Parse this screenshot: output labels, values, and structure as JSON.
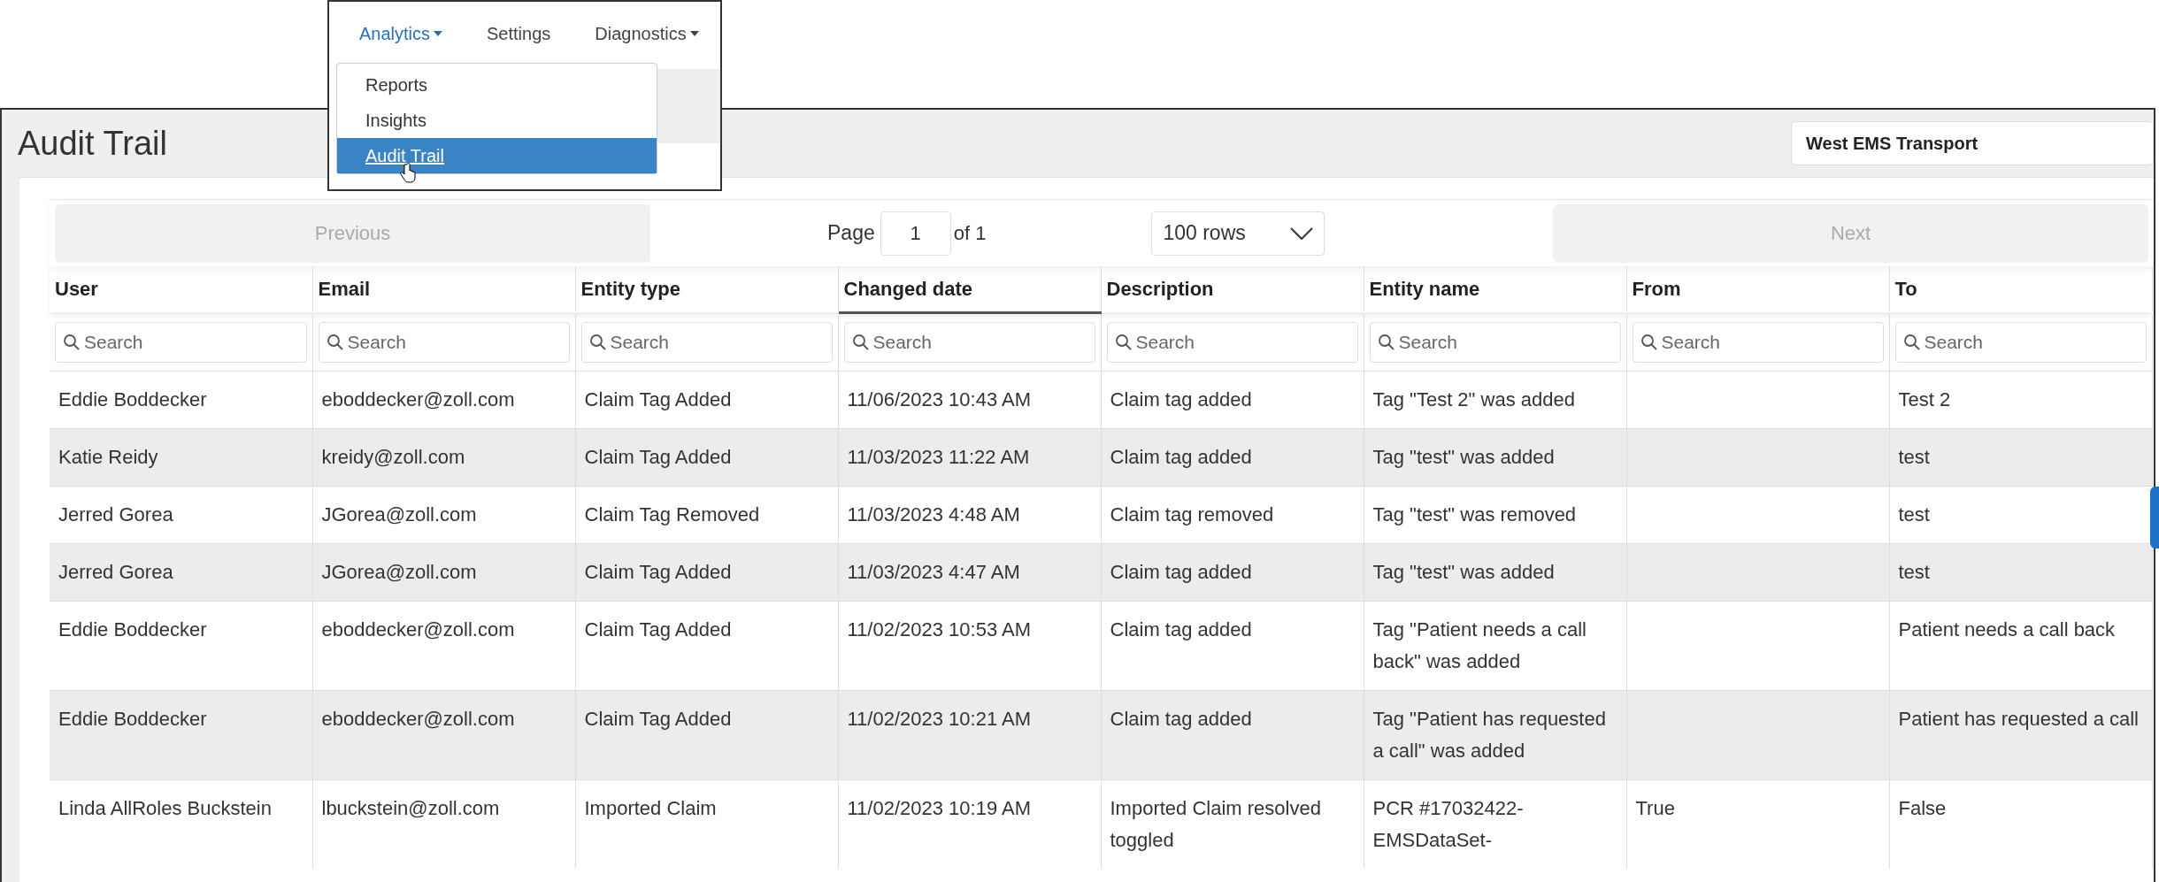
{
  "nav": {
    "items": [
      {
        "label": "Analytics",
        "selected": true,
        "dropdown": true
      },
      {
        "label": "Settings",
        "selected": false,
        "dropdown": false
      },
      {
        "label": "Diagnostics",
        "selected": false,
        "dropdown": true
      }
    ],
    "menu": [
      {
        "label": "Reports",
        "selected": false
      },
      {
        "label": "Insights",
        "selected": false
      },
      {
        "label": "Audit Trail",
        "selected": true
      }
    ]
  },
  "page": {
    "title": "Audit Trail",
    "organization": "West EMS Transport"
  },
  "pagination": {
    "previous": {
      "label": "Previous",
      "disabled": true
    },
    "page_label": "Page",
    "page": "1",
    "of": "of 1",
    "rows": "100 rows",
    "next": {
      "label": "Next",
      "disabled": true
    }
  },
  "table": {
    "columns": [
      {
        "label": "User",
        "sorted": false,
        "placeholder": "Search"
      },
      {
        "label": "Email",
        "sorted": false,
        "placeholder": "Search"
      },
      {
        "label": "Entity type",
        "sorted": false,
        "placeholder": "Search"
      },
      {
        "label": "Changed date",
        "sorted": true,
        "placeholder": "Search"
      },
      {
        "label": "Description",
        "sorted": false,
        "placeholder": "Search"
      },
      {
        "label": "Entity name",
        "sorted": false,
        "placeholder": "Search"
      },
      {
        "label": "From",
        "sorted": false,
        "placeholder": "Search"
      },
      {
        "label": "To",
        "sorted": false,
        "placeholder": "Search"
      }
    ],
    "rows": [
      [
        "Eddie Boddecker",
        "eboddecker@zoll.com",
        "Claim Tag Added",
        "11/06/2023 10:43 AM",
        "Claim tag added",
        "Tag \"Test 2\" was added",
        "",
        "Test 2"
      ],
      [
        "Katie Reidy",
        "kreidy@zoll.com",
        "Claim Tag Added",
        "11/03/2023 11:22 AM",
        "Claim tag added",
        "Tag \"test\" was added",
        "",
        "test"
      ],
      [
        "Jerred Gorea",
        "JGorea@zoll.com",
        "Claim Tag Removed",
        "11/03/2023 4:48 AM",
        "Claim tag removed",
        "Tag \"test\" was removed",
        "",
        "test"
      ],
      [
        "Jerred Gorea",
        "JGorea@zoll.com",
        "Claim Tag Added",
        "11/03/2023 4:47 AM",
        "Claim tag added",
        "Tag \"test\" was added",
        "",
        "test"
      ],
      [
        "Eddie Boddecker",
        "eboddecker@zoll.com",
        "Claim Tag Added",
        "11/02/2023 10:53 AM",
        "Claim tag added",
        "Tag \"Patient needs a call back\" was added",
        "",
        "Patient needs a call back"
      ],
      [
        "Eddie Boddecker",
        "eboddecker@zoll.com",
        "Claim Tag Added",
        "11/02/2023 10:21 AM",
        "Claim tag added",
        "Tag \"Patient has requested a call\" was added",
        "",
        "Patient has requested a call"
      ],
      [
        "Linda AllRoles Buckstein",
        "lbuckstein@zoll.com",
        "Imported Claim",
        "11/02/2023 10:19 AM",
        "Imported Claim resolved toggled",
        "PCR #17032422-EMSDataSet-",
        "True",
        "False"
      ]
    ]
  }
}
